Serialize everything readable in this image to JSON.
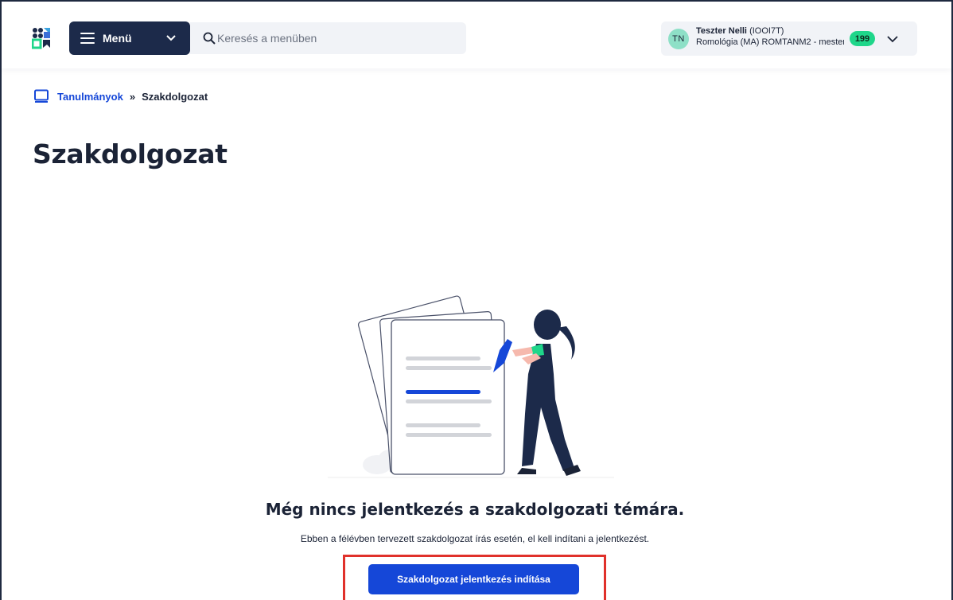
{
  "header": {
    "menu_label": "Menü",
    "search_placeholder": "Keresés a menüben",
    "user": {
      "initials": "TN",
      "name": "Teszter Nelli",
      "code": "(IOOI7T)",
      "program": "Romológia (MA) ROMTANM2 - mester...",
      "badge_count": "199"
    }
  },
  "breadcrumb": {
    "items": [
      "Tanulmányok",
      "Szakdolgozat"
    ],
    "separator": "»"
  },
  "page_title": "Szakdolgozat",
  "empty_state": {
    "title": "Még nincs jelentkezés a szakdolgozati témára.",
    "description": "Ebben a félévben tervezett szakdolgozat írás esetén, el kell indítani a jelentkezést.",
    "button_label": "Szakdolgozat jelentkezés indítása"
  },
  "colors": {
    "navy": "#1c2a4a",
    "primary_blue": "#1547d8",
    "badge_green": "#1fd68a",
    "highlight_red": "#e0312b"
  }
}
